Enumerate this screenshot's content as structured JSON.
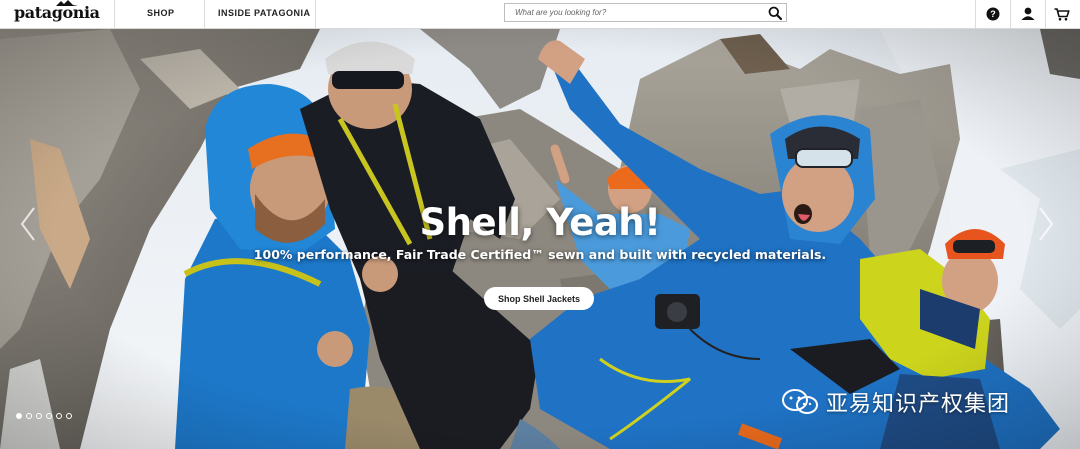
{
  "brand": {
    "name": "patagonia"
  },
  "nav": {
    "shop": "SHOP",
    "inside": "INSIDE PATAGONIA"
  },
  "search": {
    "placeholder": "What are you looking for?",
    "value": ""
  },
  "icons": {
    "help": "help-icon",
    "account": "user-icon",
    "cart": "cart-icon",
    "search": "search-icon"
  },
  "hero": {
    "headline": "Shell, Yeah!",
    "subline": "100% performance, Fair Trade Certified™ sewn and built with recycled materials.",
    "cta": "Shop Shell Jackets",
    "slide_count": 6,
    "active_slide": 1
  },
  "watermark": {
    "text": "亚易知识产权集团"
  },
  "colors": {
    "jacket_blue": "#1f6fbf",
    "helmet_orange": "#e86a1c",
    "jacket_yellow": "#d6dc1e"
  }
}
